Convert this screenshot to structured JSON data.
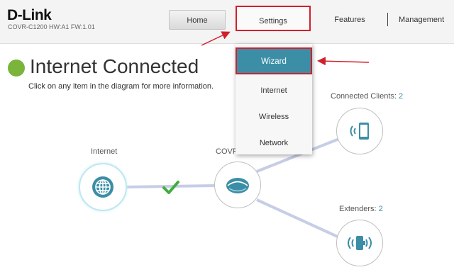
{
  "brand": {
    "logo": "D-Link",
    "model_info": "COVR-C1200 HW:A1 FW:1.01"
  },
  "nav": {
    "home": "Home",
    "settings": "Settings",
    "features": "Features",
    "management": "Management"
  },
  "settings_menu": {
    "items": [
      "Wizard",
      "Internet",
      "Wireless",
      "Network"
    ],
    "highlighted": "Wizard"
  },
  "status": {
    "title": "Internet Connected",
    "hint": "Click on any item in the diagram for more information.",
    "indicator_color": "#7ab43a"
  },
  "diagram": {
    "internet_label": "Internet",
    "covr_label": "COVR",
    "clients_label": "Connected Clients:",
    "clients_count": "2",
    "extenders_label": "Extenders:",
    "extenders_count": "2",
    "link_status": "check-icon"
  },
  "colors": {
    "accent": "#3b8ea6",
    "annotation_red": "#d11f2b",
    "connection_line": "#c7cde6",
    "check_green": "#3fae3f"
  }
}
